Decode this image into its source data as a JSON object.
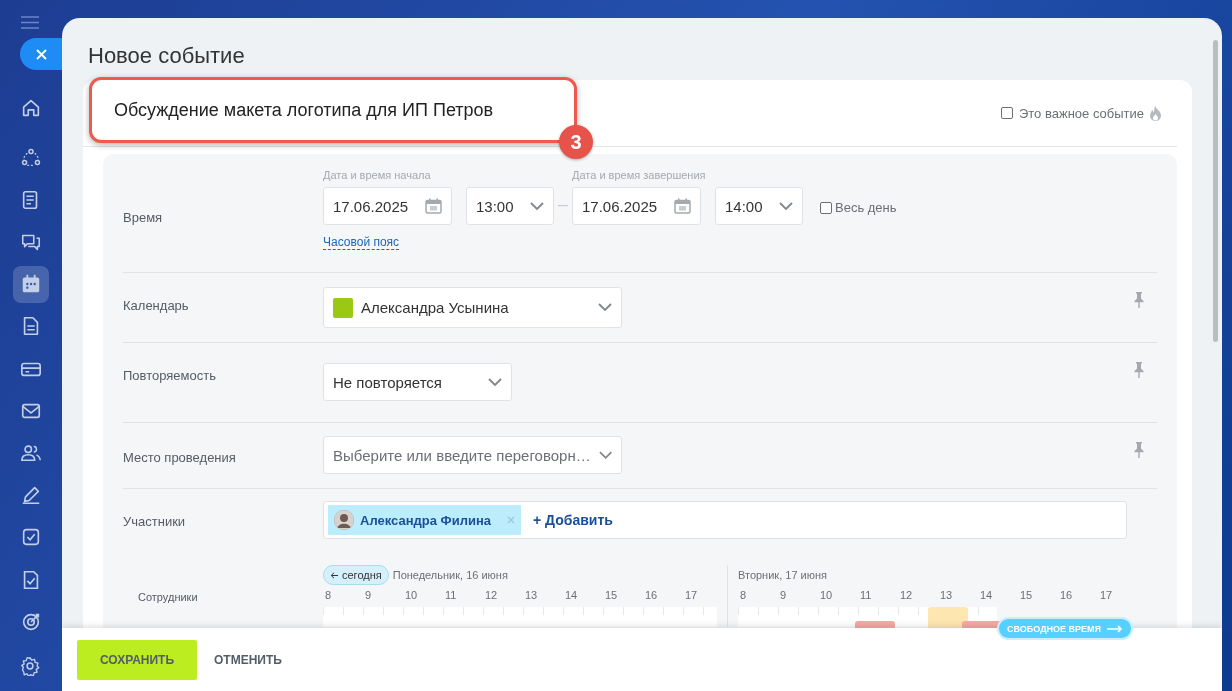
{
  "sidebar": {
    "items": [
      {
        "selected": false
      },
      {
        "selected": false
      },
      {
        "selected": false
      },
      {
        "selected": false
      },
      {
        "selected": true
      },
      {
        "selected": false
      },
      {
        "selected": false
      },
      {
        "selected": false
      },
      {
        "selected": false
      },
      {
        "selected": false
      },
      {
        "selected": false
      },
      {
        "selected": false
      },
      {
        "selected": false
      }
    ]
  },
  "window": {
    "title": "Новое событие"
  },
  "event": {
    "name": "Обсуждение макета логотипа для ИП Петров",
    "callout": "3",
    "important": {
      "label": "Это важное событие",
      "checked": false
    }
  },
  "time": {
    "label": "Время",
    "start_label": "Дата и время начала",
    "start_date": "17.06.2025",
    "start_time": "13:00",
    "end_label": "Дата и время завершения",
    "end_date": "17.06.2025",
    "end_time": "14:00",
    "all_day": {
      "label": "Весь день",
      "checked": false
    },
    "timezone_link": "Часовой пояс"
  },
  "calendar": {
    "label": "Календарь",
    "value": "Александра Усынина",
    "color": "#9bc812"
  },
  "repeat": {
    "label": "Повторяемость",
    "value": "Не повторяется"
  },
  "location": {
    "label": "Место проведения",
    "placeholder": "Выберите или введите переговорн…"
  },
  "participants": {
    "label": "Участники",
    "chips": [
      "Александра Филина"
    ],
    "add": "+ Добавить"
  },
  "schedule": {
    "today_button": "сегодня",
    "employees_label": "Сотрудники",
    "days": [
      {
        "label": "Понедельник, 16 июня",
        "hours": [
          "8",
          "9",
          "10",
          "11",
          "12",
          "13",
          "14",
          "15",
          "16",
          "17"
        ]
      },
      {
        "label": "Вторник, 17 июня",
        "hours": [
          "8",
          "9",
          "10",
          "11",
          "12",
          "13",
          "14",
          "15",
          "16",
          "17"
        ]
      }
    ],
    "free_time_button": "СВОБОДНОЕ ВРЕМЯ"
  },
  "buttons": {
    "save": "СОХРАНИТЬ",
    "cancel": "ОТМЕНИТЬ"
  }
}
